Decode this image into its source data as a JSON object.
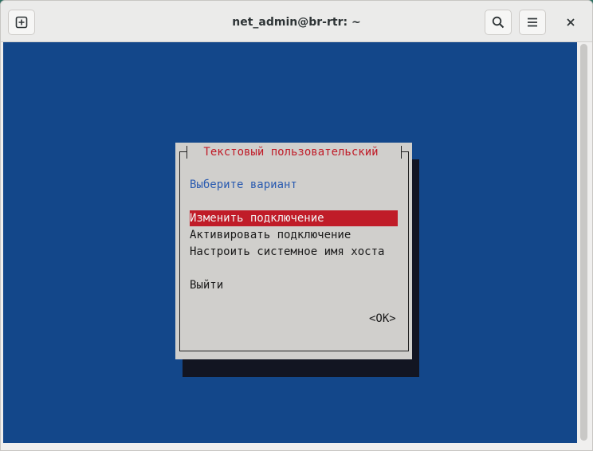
{
  "window": {
    "title": "net_admin@br-rtr: ~"
  },
  "titlebar": {
    "icons": {
      "new_tab": "new-tab-icon",
      "search": "search-icon",
      "menu": "hamburger-menu-icon",
      "close": "close-icon"
    }
  },
  "colors": {
    "terminal_bg": "#13478a",
    "dialog_bg": "#d0cfcc",
    "accent_red": "#c01c28",
    "prompt_blue": "#2a5bb0"
  },
  "dialog": {
    "title": " Текстовый пользовательский ",
    "prompt": "Выберите вариант",
    "items": [
      {
        "label": "Изменить подключение",
        "selected": true
      },
      {
        "label": "Активировать подключение",
        "selected": false
      },
      {
        "label": "Настроить системное имя хоста",
        "selected": false
      },
      {
        "label": "",
        "selected": false
      },
      {
        "label": "Выйти",
        "selected": false
      }
    ],
    "ok_label": "<OK>"
  }
}
